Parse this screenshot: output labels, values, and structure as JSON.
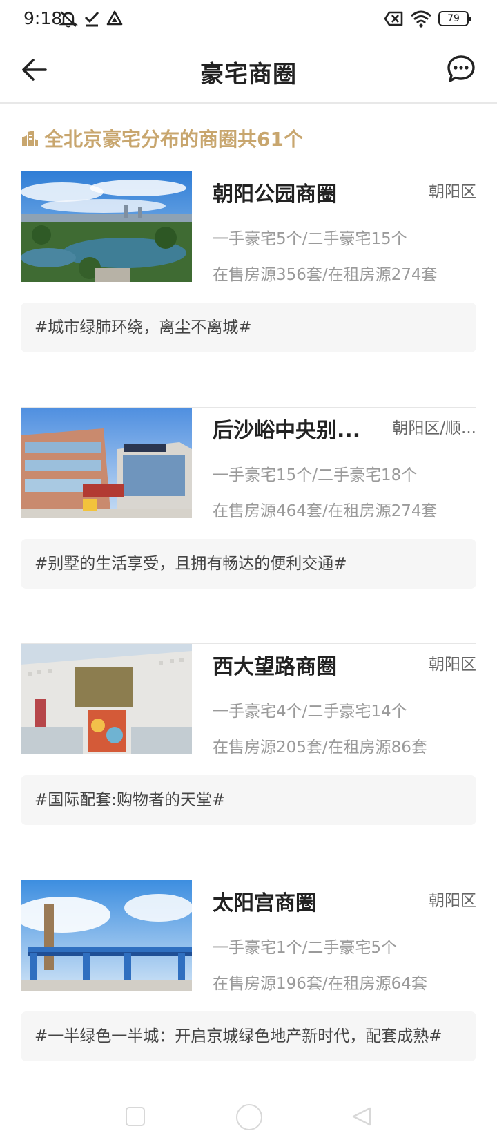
{
  "status_bar": {
    "time": "9:18",
    "battery": "79",
    "icons": [
      "mute-icon",
      "check-icon",
      "drive-icon",
      "sim-off-icon",
      "wifi-icon",
      "battery-icon"
    ]
  },
  "header": {
    "title": "豪宅商圈",
    "back_icon": "arrow-left-icon",
    "message_icon": "chat-bubble-icon"
  },
  "summary": {
    "icon": "building-icon",
    "text": "全北京豪宅分布的商圈共61个"
  },
  "districts": [
    {
      "name": "朝阳公园商圈",
      "area": "朝阳区",
      "line1": "一手豪宅5个/二手豪宅15个",
      "line2": "在售房源356套/在租房源274套",
      "tag": "#城市绿肺环绕，离尘不离城#"
    },
    {
      "name": "后沙峪中央别...",
      "area": "朝阳区/顺...",
      "line1": "一手豪宅15个/二手豪宅18个",
      "line2": "在售房源464套/在租房源274套",
      "tag": "#别墅的生活享受，且拥有畅达的便利交通#"
    },
    {
      "name": "西大望路商圈",
      "area": "朝阳区",
      "line1": "一手豪宅4个/二手豪宅14个",
      "line2": "在售房源205套/在租房源86套",
      "tag": "#国际配套:购物者的天堂#"
    },
    {
      "name": "太阳宫商圈",
      "area": "朝阳区",
      "line1": "一手豪宅1个/二手豪宅5个",
      "line2": "在售房源196套/在租房源64套",
      "tag": "#一半绿色一半城：开启京城绿色地产新时代，配套成熟#"
    }
  ],
  "colors": {
    "accent": "#c8a66e",
    "tag_bg": "#f6f6f6",
    "muted_text": "#9a9a9a"
  }
}
